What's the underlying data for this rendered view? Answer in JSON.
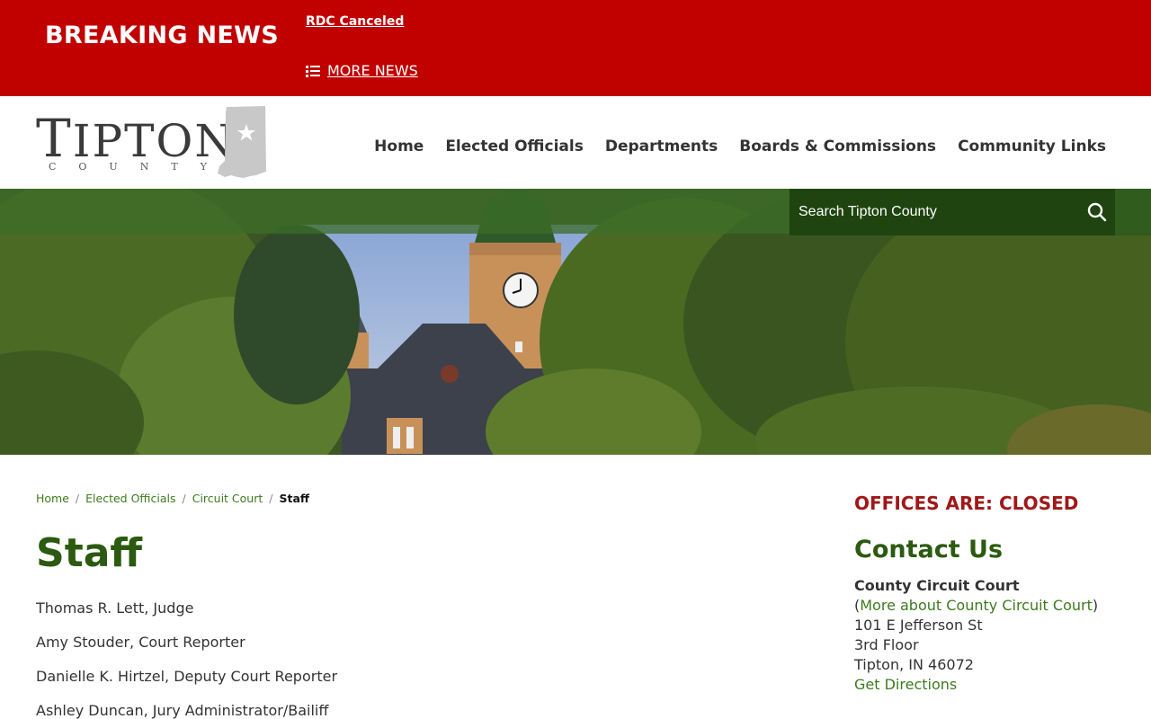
{
  "breaking": {
    "title": "BREAKING NEWS",
    "item": "RDC Canceled",
    "more": "MORE NEWS"
  },
  "logo": {
    "word_first": "T",
    "word_rest": "IPTON",
    "sub": "COUNTY"
  },
  "nav": [
    "Home",
    "Elected Officials",
    "Departments",
    "Boards & Commissions",
    "Community Links"
  ],
  "search": {
    "placeholder": "Search Tipton County"
  },
  "breadcrumb": {
    "items": [
      "Home",
      "Elected Officials",
      "Circuit Court"
    ],
    "current": "Staff"
  },
  "page": {
    "title": "Staff",
    "staff": [
      "Thomas R. Lett, Judge",
      "Amy Stouder, Court Reporter",
      "Danielle K. Hirtzel, Deputy Court Reporter",
      "Ashley Duncan, Jury Administrator/Bailiff"
    ]
  },
  "sidebar": {
    "status": "OFFICES ARE: CLOSED",
    "contact_heading": "Contact Us",
    "office_name": "County Circuit Court",
    "more_open": "(",
    "more_link": "More about County Circuit Court",
    "more_close": ")",
    "address1": "101 E Jefferson St",
    "address2": "3rd Floor",
    "city": "Tipton, IN 46072",
    "directions": "Get Directions"
  },
  "colors": {
    "breaking_red": "#c10000",
    "brand_green": "#2b5a10",
    "link_green": "#3d7a1e",
    "closed_red": "#a01818"
  }
}
